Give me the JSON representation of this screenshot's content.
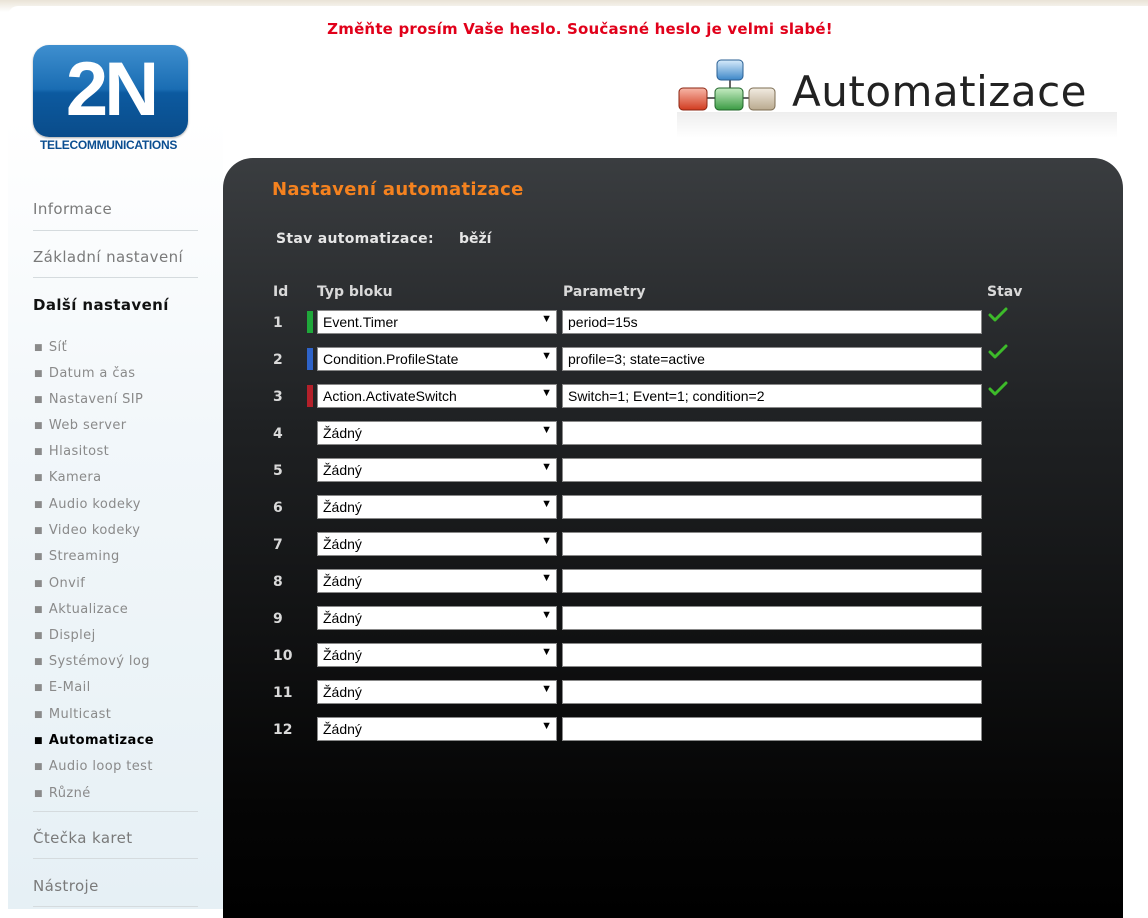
{
  "warning": "Změňte prosím Vaše heslo. Současné heslo je velmi slabé!",
  "logo": {
    "mark": "2N",
    "subtitle": "TELECOMMUNICATIONS"
  },
  "header": {
    "title": "Automatizace",
    "icon": "automation-blocks-icon"
  },
  "sidebar": {
    "main_items": [
      {
        "label": "Informace"
      },
      {
        "label": "Základní nastavení"
      },
      {
        "label": "Další nastavení",
        "active": true
      },
      {
        "label": "Čtečka karet"
      },
      {
        "label": "Nástroje"
      }
    ],
    "sub_items": [
      {
        "label": "Síť"
      },
      {
        "label": "Datum a čas"
      },
      {
        "label": "Nastavení SIP"
      },
      {
        "label": "Web server"
      },
      {
        "label": "Hlasitost"
      },
      {
        "label": "Kamera"
      },
      {
        "label": "Audio kodeky"
      },
      {
        "label": "Video kodeky"
      },
      {
        "label": "Streaming"
      },
      {
        "label": "Onvif"
      },
      {
        "label": "Aktualizace"
      },
      {
        "label": "Displej"
      },
      {
        "label": "Systémový log"
      },
      {
        "label": "E-Mail"
      },
      {
        "label": "Multicast"
      },
      {
        "label": "Automatizace",
        "active": true
      },
      {
        "label": "Audio loop test"
      },
      {
        "label": "Různé"
      }
    ]
  },
  "main": {
    "title": "Nastavení automatizace",
    "status_label": "Stav automatizace:",
    "status_value": "běží",
    "columns": {
      "id": "Id",
      "type": "Typ bloku",
      "params": "Parametry",
      "state": "Stav"
    },
    "rows": [
      {
        "id": "1",
        "type": "Event.Timer",
        "params": "period=15s",
        "marker": "#1fa83a",
        "ok": true
      },
      {
        "id": "2",
        "type": "Condition.ProfileState",
        "params": "profile=3; state=active",
        "marker": "#2e63c9",
        "ok": true
      },
      {
        "id": "3",
        "type": "Action.ActivateSwitch",
        "params": "Switch=1; Event=1; condition=2",
        "marker": "#b3202a",
        "ok": true
      },
      {
        "id": "4",
        "type": "Žádný",
        "params": ""
      },
      {
        "id": "5",
        "type": "Žádný",
        "params": ""
      },
      {
        "id": "6",
        "type": "Žádný",
        "params": ""
      },
      {
        "id": "7",
        "type": "Žádný",
        "params": ""
      },
      {
        "id": "8",
        "type": "Žádný",
        "params": ""
      },
      {
        "id": "9",
        "type": "Žádný",
        "params": ""
      },
      {
        "id": "10",
        "type": "Žádný",
        "params": ""
      },
      {
        "id": "11",
        "type": "Žádný",
        "params": ""
      },
      {
        "id": "12",
        "type": "Žádný",
        "params": ""
      }
    ]
  },
  "colors": {
    "accent": "#f5821f",
    "warning": "#e1001a",
    "check": "#3dbb2a"
  }
}
